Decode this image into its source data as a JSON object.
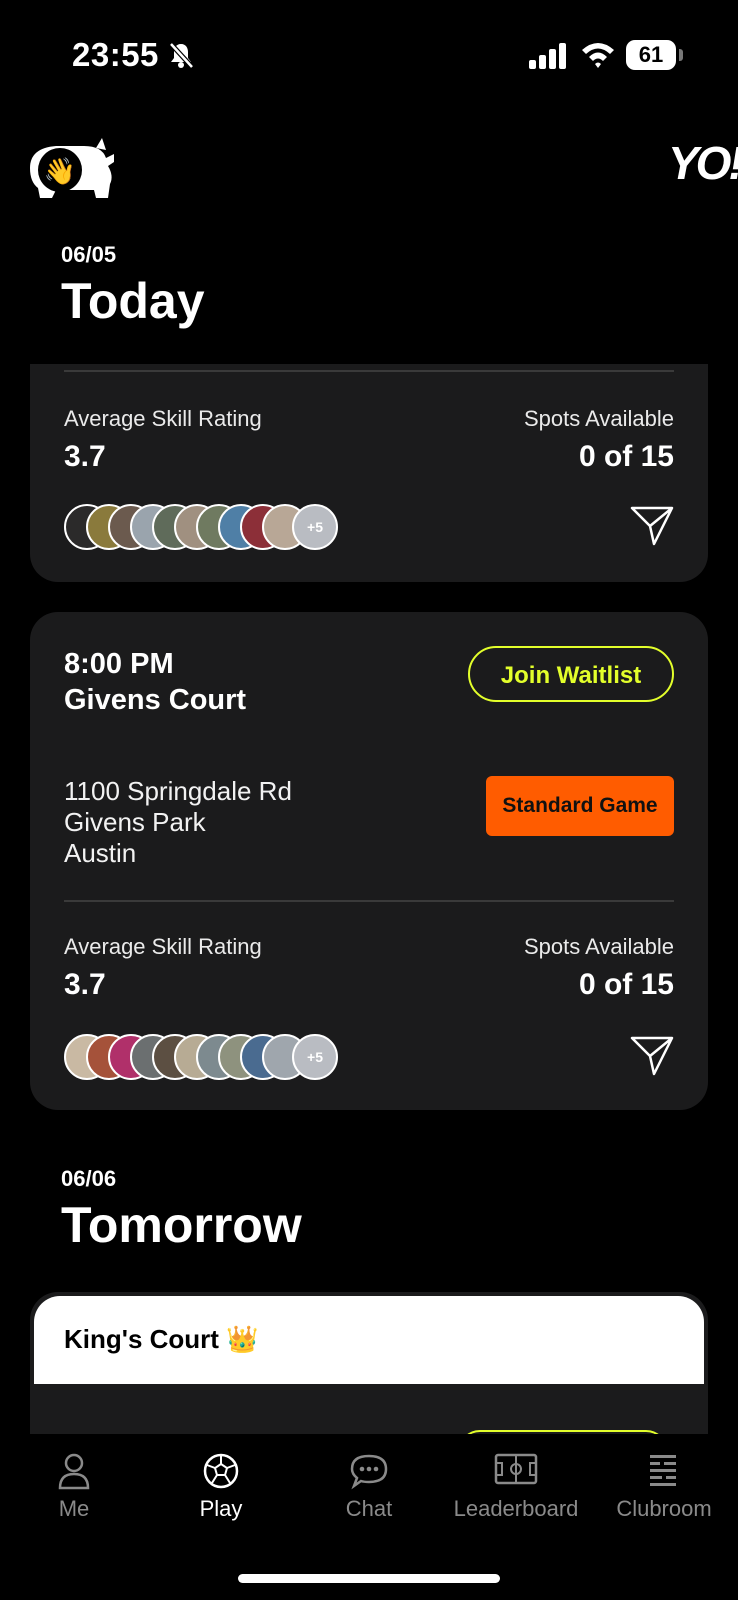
{
  "status": {
    "time": "23:55",
    "battery": "61"
  },
  "header": {
    "logo_right": "YO!"
  },
  "sections": [
    {
      "date": "06/05",
      "title": "Today"
    },
    {
      "date": "06/06",
      "title": "Tomorrow"
    }
  ],
  "card1": {
    "skill_label": "Average Skill Rating",
    "skill_value": "3.7",
    "spots_label": "Spots Available",
    "spots_value": "0 of 15",
    "more_players": "+5"
  },
  "card2": {
    "time": "8:00 PM",
    "court": "Givens Court",
    "action_label": "Join Waitlist",
    "game_type": "Standard Game",
    "address_line1": "1100 Springdale Rd",
    "address_line2": "Givens Park",
    "address_line3": "Austin",
    "skill_label": "Average Skill Rating",
    "skill_value": "3.7",
    "spots_label": "Spots Available",
    "spots_value": "0 of 15",
    "more_players": "+5"
  },
  "card3": {
    "title": "King's Court 👑"
  },
  "tabs": [
    {
      "label": "Me",
      "icon": "person-icon"
    },
    {
      "label": "Play",
      "icon": "soccer-ball-icon",
      "active": true
    },
    {
      "label": "Chat",
      "icon": "chat-bubble-icon"
    },
    {
      "label": "Leaderboard",
      "icon": "pitch-icon"
    },
    {
      "label": "Clubroom",
      "icon": "tactics-board-icon"
    }
  ],
  "colors": {
    "accent": "#e3ff2b",
    "game_type": "#ff5c00",
    "card_bg": "#1b1b1c"
  }
}
